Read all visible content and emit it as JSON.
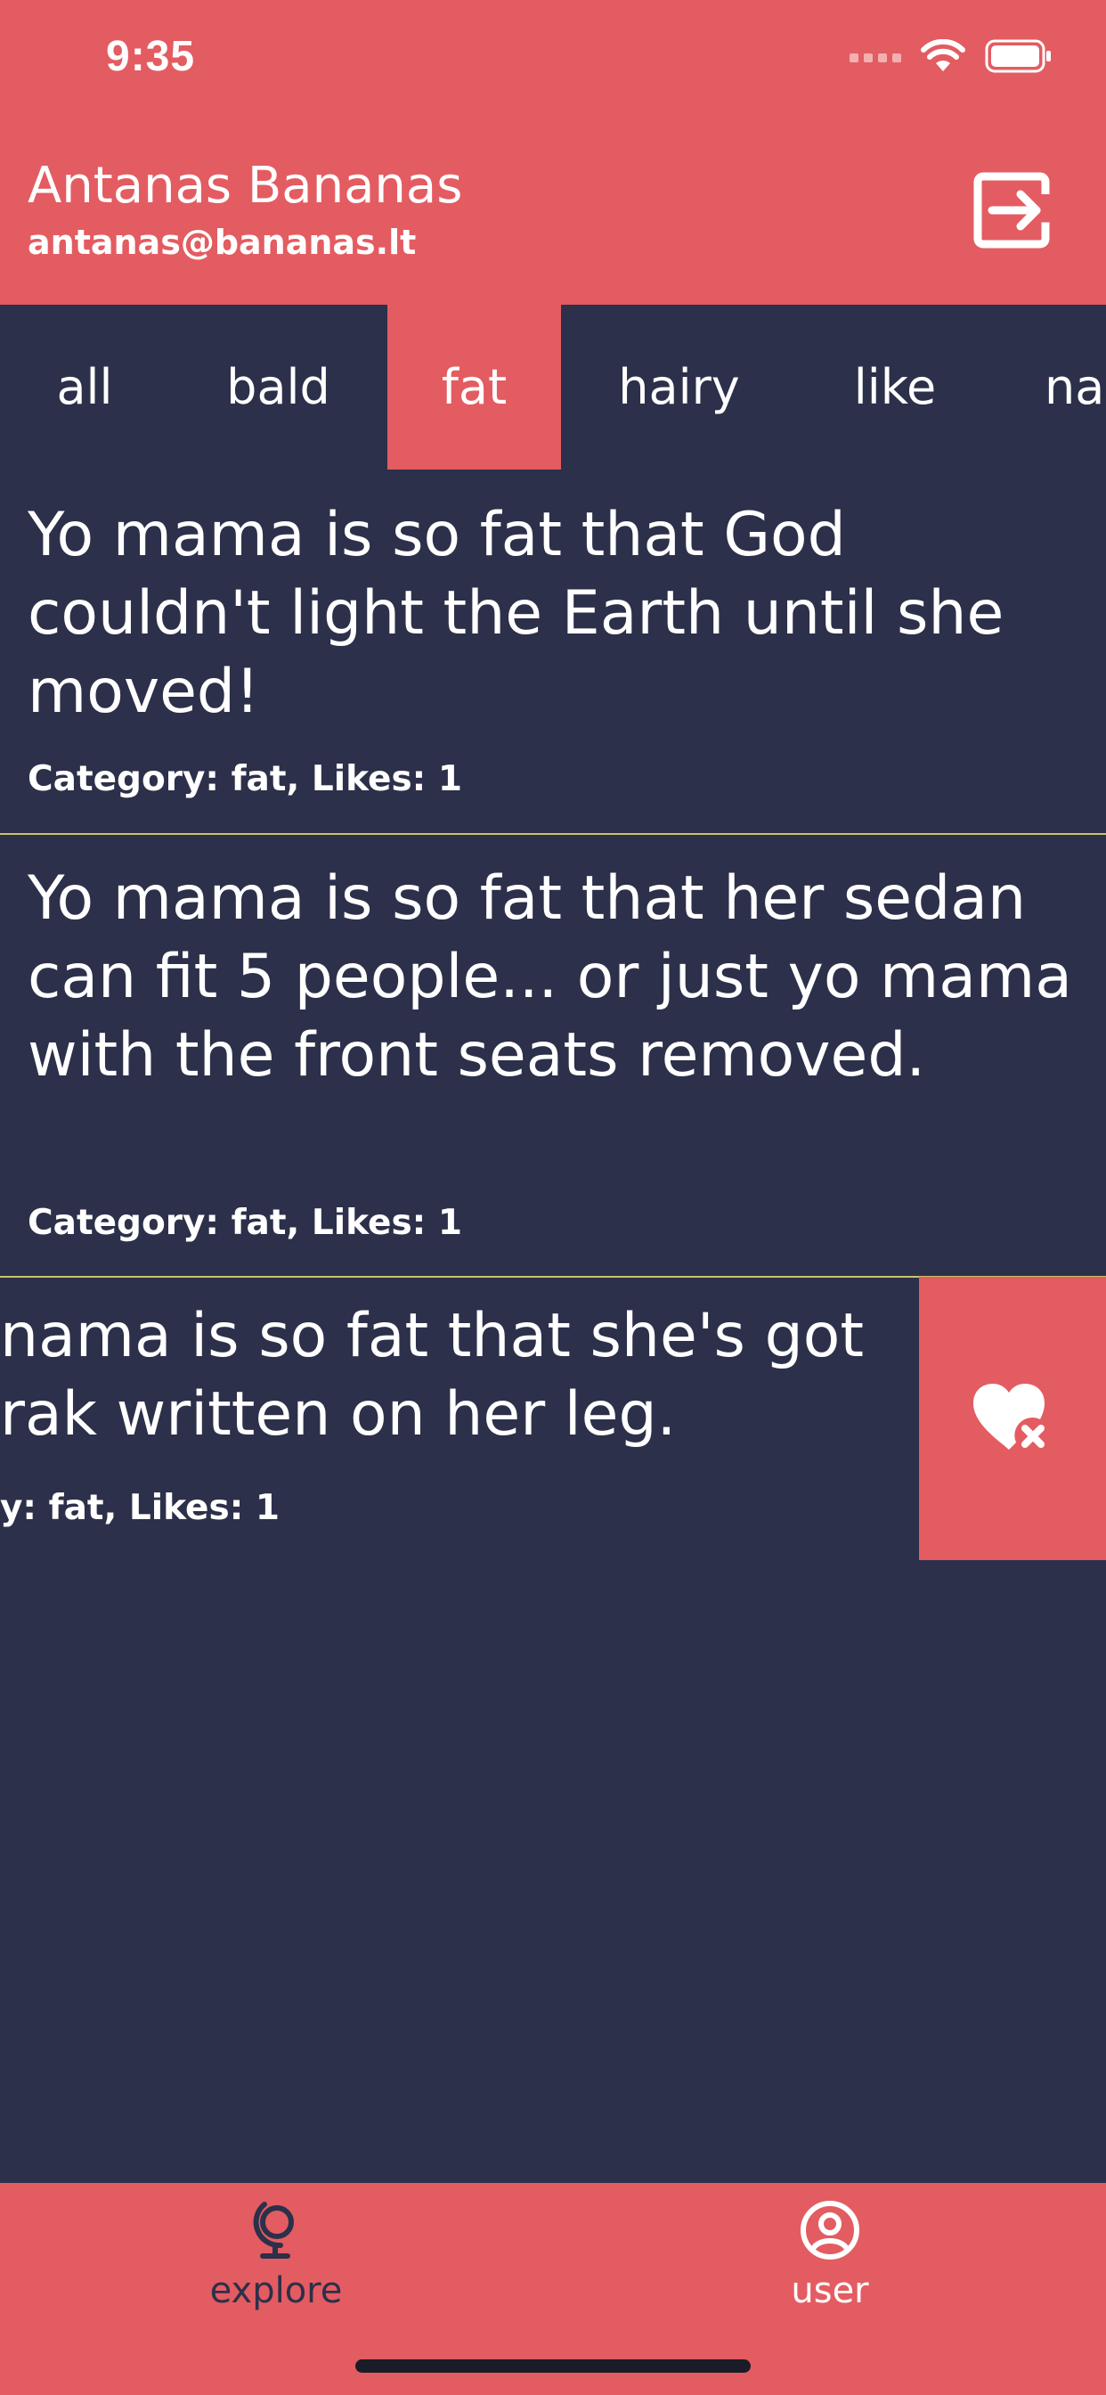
{
  "status_bar": {
    "time": "9:35"
  },
  "header": {
    "user_name": "Antanas Bananas",
    "user_email": "antanas@bananas.lt",
    "logout_icon": "logout-icon"
  },
  "tabs": [
    {
      "label": "all",
      "active": false
    },
    {
      "label": "bald",
      "active": false
    },
    {
      "label": "fat",
      "active": true
    },
    {
      "label": "hairy",
      "active": false
    },
    {
      "label": "like",
      "active": false
    },
    {
      "label": "na",
      "active": false
    }
  ],
  "jokes": [
    {
      "text": "Yo mama is so fat that God couldn't light the Earth until she moved!",
      "meta": "Category: fat, Likes: 1"
    },
    {
      "text": "Yo mama is so fat that her sedan can fit 5 people... or just yo mama with the front seats removed.",
      "meta": "Category: fat, Likes: 1"
    },
    {
      "text_line1": "nama is so fat that she's got",
      "text_line2": "rak written on her leg.",
      "meta": "y: fat, Likes: 1"
    }
  ],
  "swipe_action": {
    "icon": "heart-remove-icon"
  },
  "bottom_nav": {
    "items": [
      {
        "label": "explore",
        "icon": "globe-icon",
        "active": true
      },
      {
        "label": "user",
        "icon": "user-circle-icon",
        "active": false
      }
    ]
  },
  "colors": {
    "accent": "#e35c61",
    "background": "#2c304a",
    "divider": "#c9c46a",
    "nav_active": "#2c304a",
    "nav_inactive": "#ffffff"
  }
}
